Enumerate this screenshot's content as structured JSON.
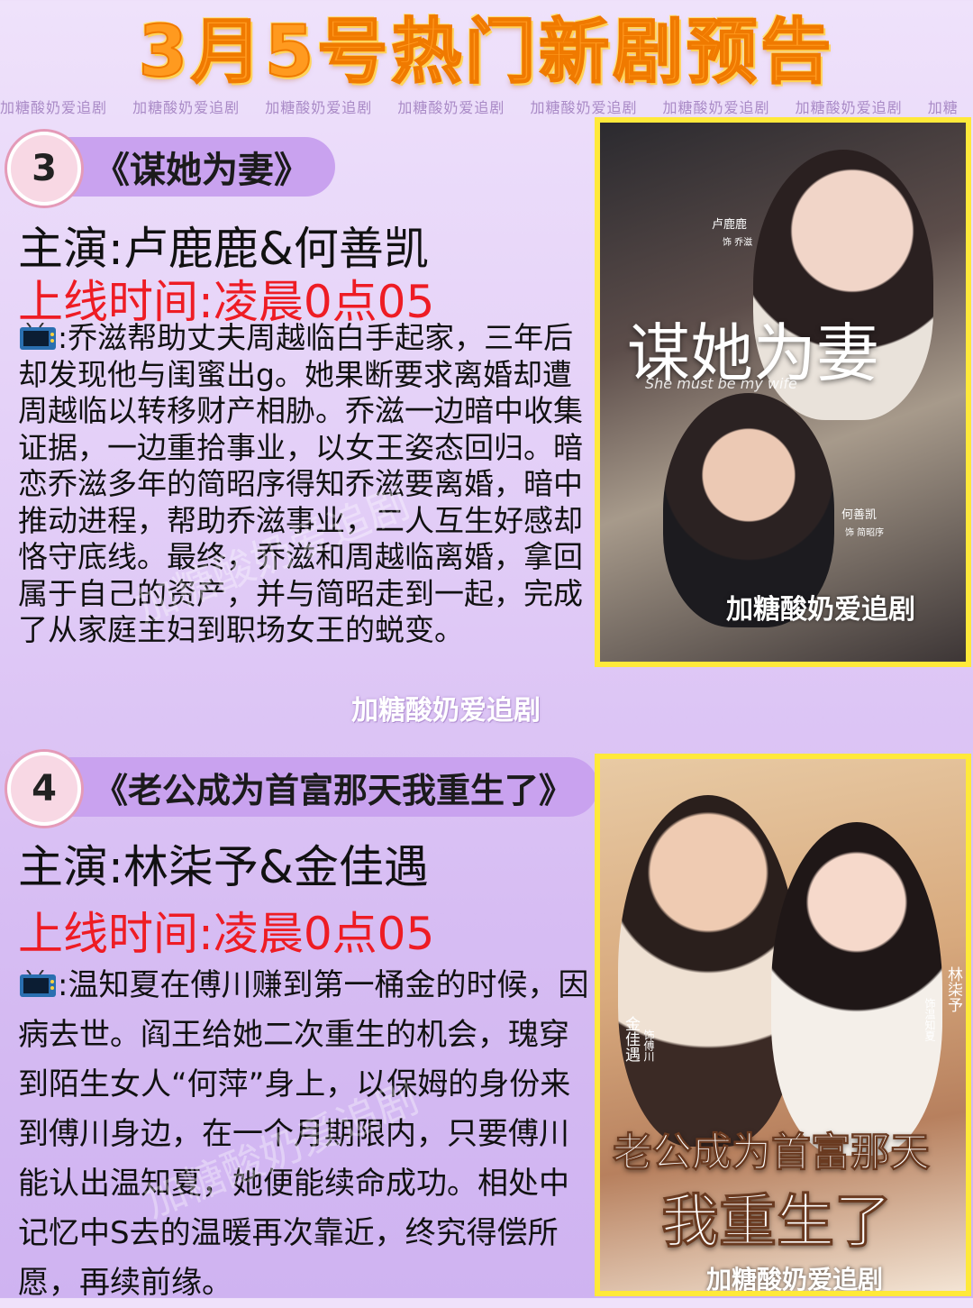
{
  "header": {
    "title": "3月5号热门新剧预告"
  },
  "watermark": {
    "text": "加糖酸奶爱追剧",
    "strip": [
      "加糖酸奶爱追剧",
      "加糖酸奶爱追剧",
      "加糖酸奶爱追剧",
      "加糖酸奶爱追剧",
      "加糖酸奶爱追剧",
      "加糖酸奶爱追剧",
      "加糖酸奶爱追剧",
      "加糖"
    ]
  },
  "shows": [
    {
      "number": "3",
      "title": "《谋她为妻》",
      "cast": "主演:卢鹿鹿&何善凯",
      "air_time": "上线时间:凌晨0点05",
      "synopsis": ":乔滋帮助丈夫周越临白手起家，三年后却发现他与闺蜜出g。她果断要求离婚却遭周越临以转移财产相胁。乔滋一边暗中收集证据，一边重拾事业，以女王姿态回归。暗恋乔滋多年的简昭序得知乔滋要离婚，暗中推动进程，帮助乔滋事业，二人互生好感却恪守底线。最终，乔滋和周越临离婚，拿回属于自己的资产，并与简昭走到一起，完成了从家庭主妇到职场女王的蜕变。",
      "poster": {
        "title": "谋她为妻",
        "subtitle": "She must be my wife",
        "actor1": "卢鹿鹿",
        "role1": "饰 乔滋",
        "actor2": "何善凯",
        "role2": "饰 简昭序"
      }
    },
    {
      "number": "4",
      "title": "《老公成为首富那天我重生了》",
      "cast": "主演:林柒予&金佳遇",
      "air_time": "上线时间:凌晨0点05",
      "synopsis": ":温知夏在傅川赚到第一桶金的时候，因病去世。阎王给她二次重生的机会，瑰穿到陌生女人“何萍”身上，以保姆的身份来到傅川身边，在一个月期限内，只要傅川能认出温知夏，她便能续命成功。相处中记忆中S去的温暖再次靠近，终究得偿所愿，再续前缘。",
      "poster": {
        "title_line1": "老公成为首富那天",
        "title_line2": "我重生了",
        "actor1": "林柒予",
        "role1": "饰温知夏",
        "actor2": "金佳遇",
        "role2": "饰傅川"
      }
    }
  ],
  "icons": {
    "tv": "tv-icon"
  },
  "colors": {
    "accent_red": "#ee1c24",
    "title_orange": "#ff9a1f",
    "pill": "#c9a2ef",
    "poster_border": "#ffe93a"
  }
}
